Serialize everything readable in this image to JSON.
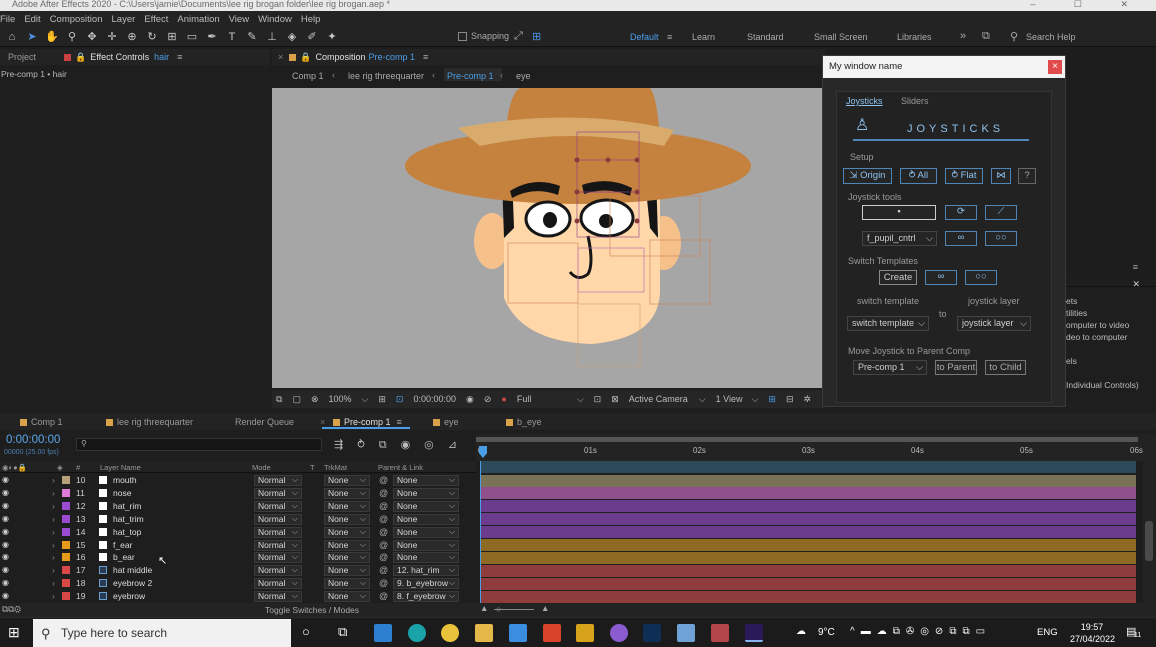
{
  "titlebar": {
    "text": "Adobe After Effects 2020 - C:\\Users\\jamie\\Documents\\lee rig brogan folder\\lee rig brogan.aep *"
  },
  "menu": [
    "File",
    "Edit",
    "Composition",
    "Layer",
    "Effect",
    "Animation",
    "View",
    "Window",
    "Help"
  ],
  "toolbar": {
    "snapping": "Snapping",
    "workspaces": [
      "Default",
      "Learn",
      "Standard",
      "Small Screen",
      "Libraries"
    ],
    "active_workspace": "Default",
    "search_placeholder": "Search Help"
  },
  "left_panel": {
    "tab_project": "Project",
    "tab_effect_controls": "Effect Controls",
    "effect_layer": "hair",
    "breadcrumb": "Pre-comp 1 • hair"
  },
  "comp_panel": {
    "tab_label": "Composition",
    "comp_name": "Pre-comp 1",
    "breadcrumbs": [
      "Comp 1",
      "lee rig threequarter",
      "Pre-comp 1",
      "eye"
    ],
    "active_breadcrumb": "Pre-comp 1",
    "zoom": "100%",
    "timecode": "0:00:00:00",
    "resolution": "Full",
    "camera": "Active Camera",
    "view": "1 View"
  },
  "plugin": {
    "window_title": "My window name",
    "close": "×",
    "tabs": [
      "Joysticks",
      "Sliders"
    ],
    "active_tab": "Joysticks",
    "logo_text": "JOYSTICKS",
    "setup_label": "Setup",
    "setup_buttons": [
      "Origin",
      "All",
      "Flat"
    ],
    "help": "?",
    "joystick_tools_label": "Joystick tools",
    "control_dropdown": "f_pupil_cntrl",
    "switch_templates_label": "Switch Templates",
    "create_button": "Create",
    "switch_template_label": "switch template",
    "joystick_layer_label": "joystick layer",
    "to_label": "to",
    "switch_template_dropdown": "switch template",
    "joystick_layer_dropdown": "joystick layer",
    "move_label": "Move Joystick to Parent Comp",
    "precomp_dropdown": "Pre-comp 1",
    "to_parent": "to Parent",
    "to_child": "to Child"
  },
  "right_panel": {
    "items": [
      "ets",
      "tilities",
      "omputer to video",
      "deo to computer",
      "els",
      "Individual Controls)"
    ]
  },
  "timeline": {
    "tabs": [
      {
        "label": "Comp 1",
        "color": "#d8a14a"
      },
      {
        "label": "lee rig threequarter",
        "color": "#d8a14a"
      },
      {
        "label": "Render Queue",
        "color": ""
      },
      {
        "label": "Pre-comp 1",
        "color": "#d8a14a"
      },
      {
        "label": "eye",
        "color": "#d8a14a"
      },
      {
        "label": "b_eye",
        "color": "#d8a14a"
      }
    ],
    "active_tab": "Pre-comp 1",
    "timecode": "0:00:00:00",
    "fps": "00000 (25.00 fps)",
    "search_placeholder": "",
    "columns": {
      "num": "#",
      "name": "Layer Name",
      "mode": "Mode",
      "t": "T",
      "trkmat": "TrkMat",
      "parent": "Parent & Link"
    },
    "ruler_labels": [
      "0s",
      "01s",
      "02s",
      "03s",
      "04s",
      "05s",
      "06s"
    ],
    "layers": [
      {
        "num": "10",
        "name": "mouth",
        "color": "#b8a07a",
        "bar": "#7a7256",
        "mode": "Normal",
        "trkmat": "None",
        "parent": "None",
        "precomp": false
      },
      {
        "num": "11",
        "name": "nose",
        "color": "#e07ad8",
        "bar": "#8e4f8a",
        "mode": "Normal",
        "trkmat": "None",
        "parent": "None",
        "precomp": false
      },
      {
        "num": "12",
        "name": "hat_rim",
        "color": "#9b4ad2",
        "bar": "#6b3c8e",
        "mode": "Normal",
        "trkmat": "None",
        "parent": "None",
        "precomp": false
      },
      {
        "num": "13",
        "name": "hat_trim",
        "color": "#9b4ad2",
        "bar": "#6b3c8e",
        "mode": "Normal",
        "trkmat": "None",
        "parent": "None",
        "precomp": false
      },
      {
        "num": "14",
        "name": "hat_top",
        "color": "#9b4ad2",
        "bar": "#6b3c8e",
        "mode": "Normal",
        "trkmat": "None",
        "parent": "None",
        "precomp": false
      },
      {
        "num": "15",
        "name": "f_ear",
        "color": "#e79a1a",
        "bar": "#8f6a22",
        "mode": "Normal",
        "trkmat": "None",
        "parent": "None",
        "precomp": false
      },
      {
        "num": "16",
        "name": "b_ear",
        "color": "#e79a1a",
        "bar": "#8f6a22",
        "mode": "Normal",
        "trkmat": "None",
        "parent": "None",
        "precomp": false
      },
      {
        "num": "17",
        "name": "hat middle",
        "color": "#d94848",
        "bar": "#8e3c3c",
        "mode": "Normal",
        "trkmat": "None",
        "parent": "12. hat_rim",
        "precomp": true
      },
      {
        "num": "18",
        "name": "eyebrow 2",
        "color": "#d94848",
        "bar": "#8e3c3c",
        "mode": "Normal",
        "trkmat": "None",
        "parent": "9. b_eyebrow",
        "precomp": true
      },
      {
        "num": "19",
        "name": "eyebrow",
        "color": "#d94848",
        "bar": "#8e3c3c",
        "mode": "Normal",
        "trkmat": "None",
        "parent": "8. f_eyebrow",
        "precomp": true
      }
    ],
    "footer_toggle": "Toggle Switches / Modes"
  },
  "taskbar": {
    "search_placeholder": "Type here to search",
    "weather": "9°C",
    "language": "ENG",
    "time": "19:57",
    "date": "27/04/2022",
    "notifications": "11"
  }
}
